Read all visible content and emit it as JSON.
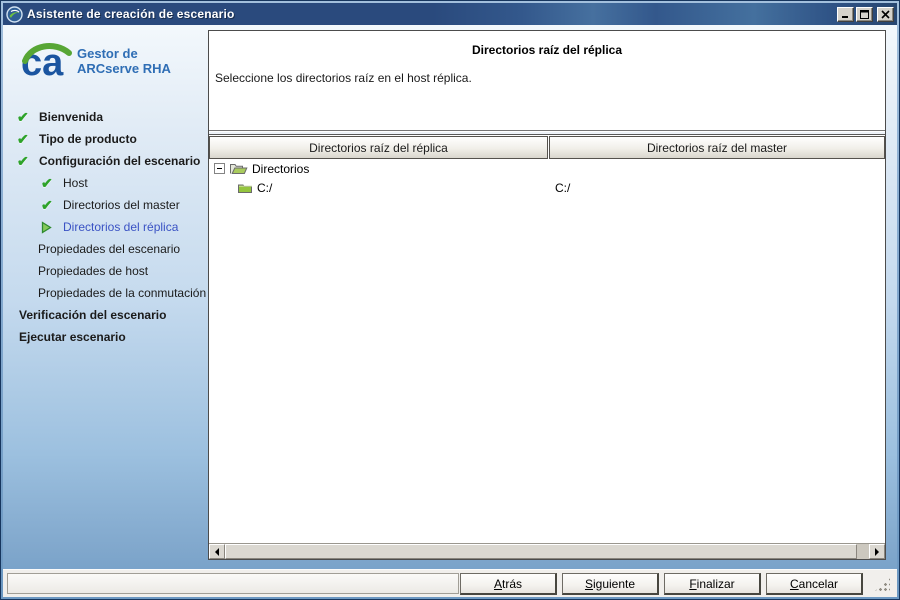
{
  "window": {
    "title": "Asistente de creación de escenario"
  },
  "branding": {
    "logo_text": "ca",
    "product_line1": "Gestor de",
    "product_line2": "ARCserve RHA"
  },
  "sidebar": {
    "items": [
      {
        "label": "Bienvenida",
        "level": 0,
        "state": "done"
      },
      {
        "label": "Tipo de producto",
        "level": 0,
        "state": "done"
      },
      {
        "label": "Configuración del escenario",
        "level": 0,
        "state": "done"
      },
      {
        "label": "Host",
        "level": 1,
        "state": "done"
      },
      {
        "label": "Directorios del master",
        "level": 1,
        "state": "done"
      },
      {
        "label": "Directorios del réplica",
        "level": 1,
        "state": "current"
      },
      {
        "label": "Propiedades del escenario",
        "level": 1,
        "state": "pending"
      },
      {
        "label": "Propiedades de host",
        "level": 1,
        "state": "pending"
      },
      {
        "label": "Propiedades de la conmutación",
        "level": 1,
        "state": "pending"
      },
      {
        "label": "Verificación del escenario",
        "level": 0,
        "state": "pending"
      },
      {
        "label": "Ejecutar escenario",
        "level": 0,
        "state": "pending"
      }
    ]
  },
  "content": {
    "heading": "Directorios raíz del réplica",
    "description": "Seleccione los directorios raíz en el host réplica.",
    "grid": {
      "columns": [
        "Directorios raíz del réplica",
        "Directorios raíz del master"
      ],
      "root_label": "Directorios",
      "rows": [
        {
          "replica": "C:/",
          "master": "C:/"
        }
      ]
    }
  },
  "footer": {
    "buttons": [
      {
        "label": "Atrás",
        "mnemonic": "A",
        "rest": "trás"
      },
      {
        "label": "Siguiente",
        "mnemonic": "S",
        "rest": "iguiente"
      },
      {
        "label": "Finalizar",
        "mnemonic": "F",
        "rest": "inalizar"
      },
      {
        "label": "Cancelar",
        "mnemonic": "C",
        "rest": "ancelar"
      }
    ]
  },
  "colors": {
    "titlebar_blue": "#2a4a7d",
    "frame_blue": "#7aa2cc",
    "check_green": "#2ea32a",
    "current_step_blue": "#3a52c4",
    "folder_green": "#94c53e",
    "ca_logo_blue": "#1b55a0",
    "ca_logo_green": "#57a635"
  }
}
